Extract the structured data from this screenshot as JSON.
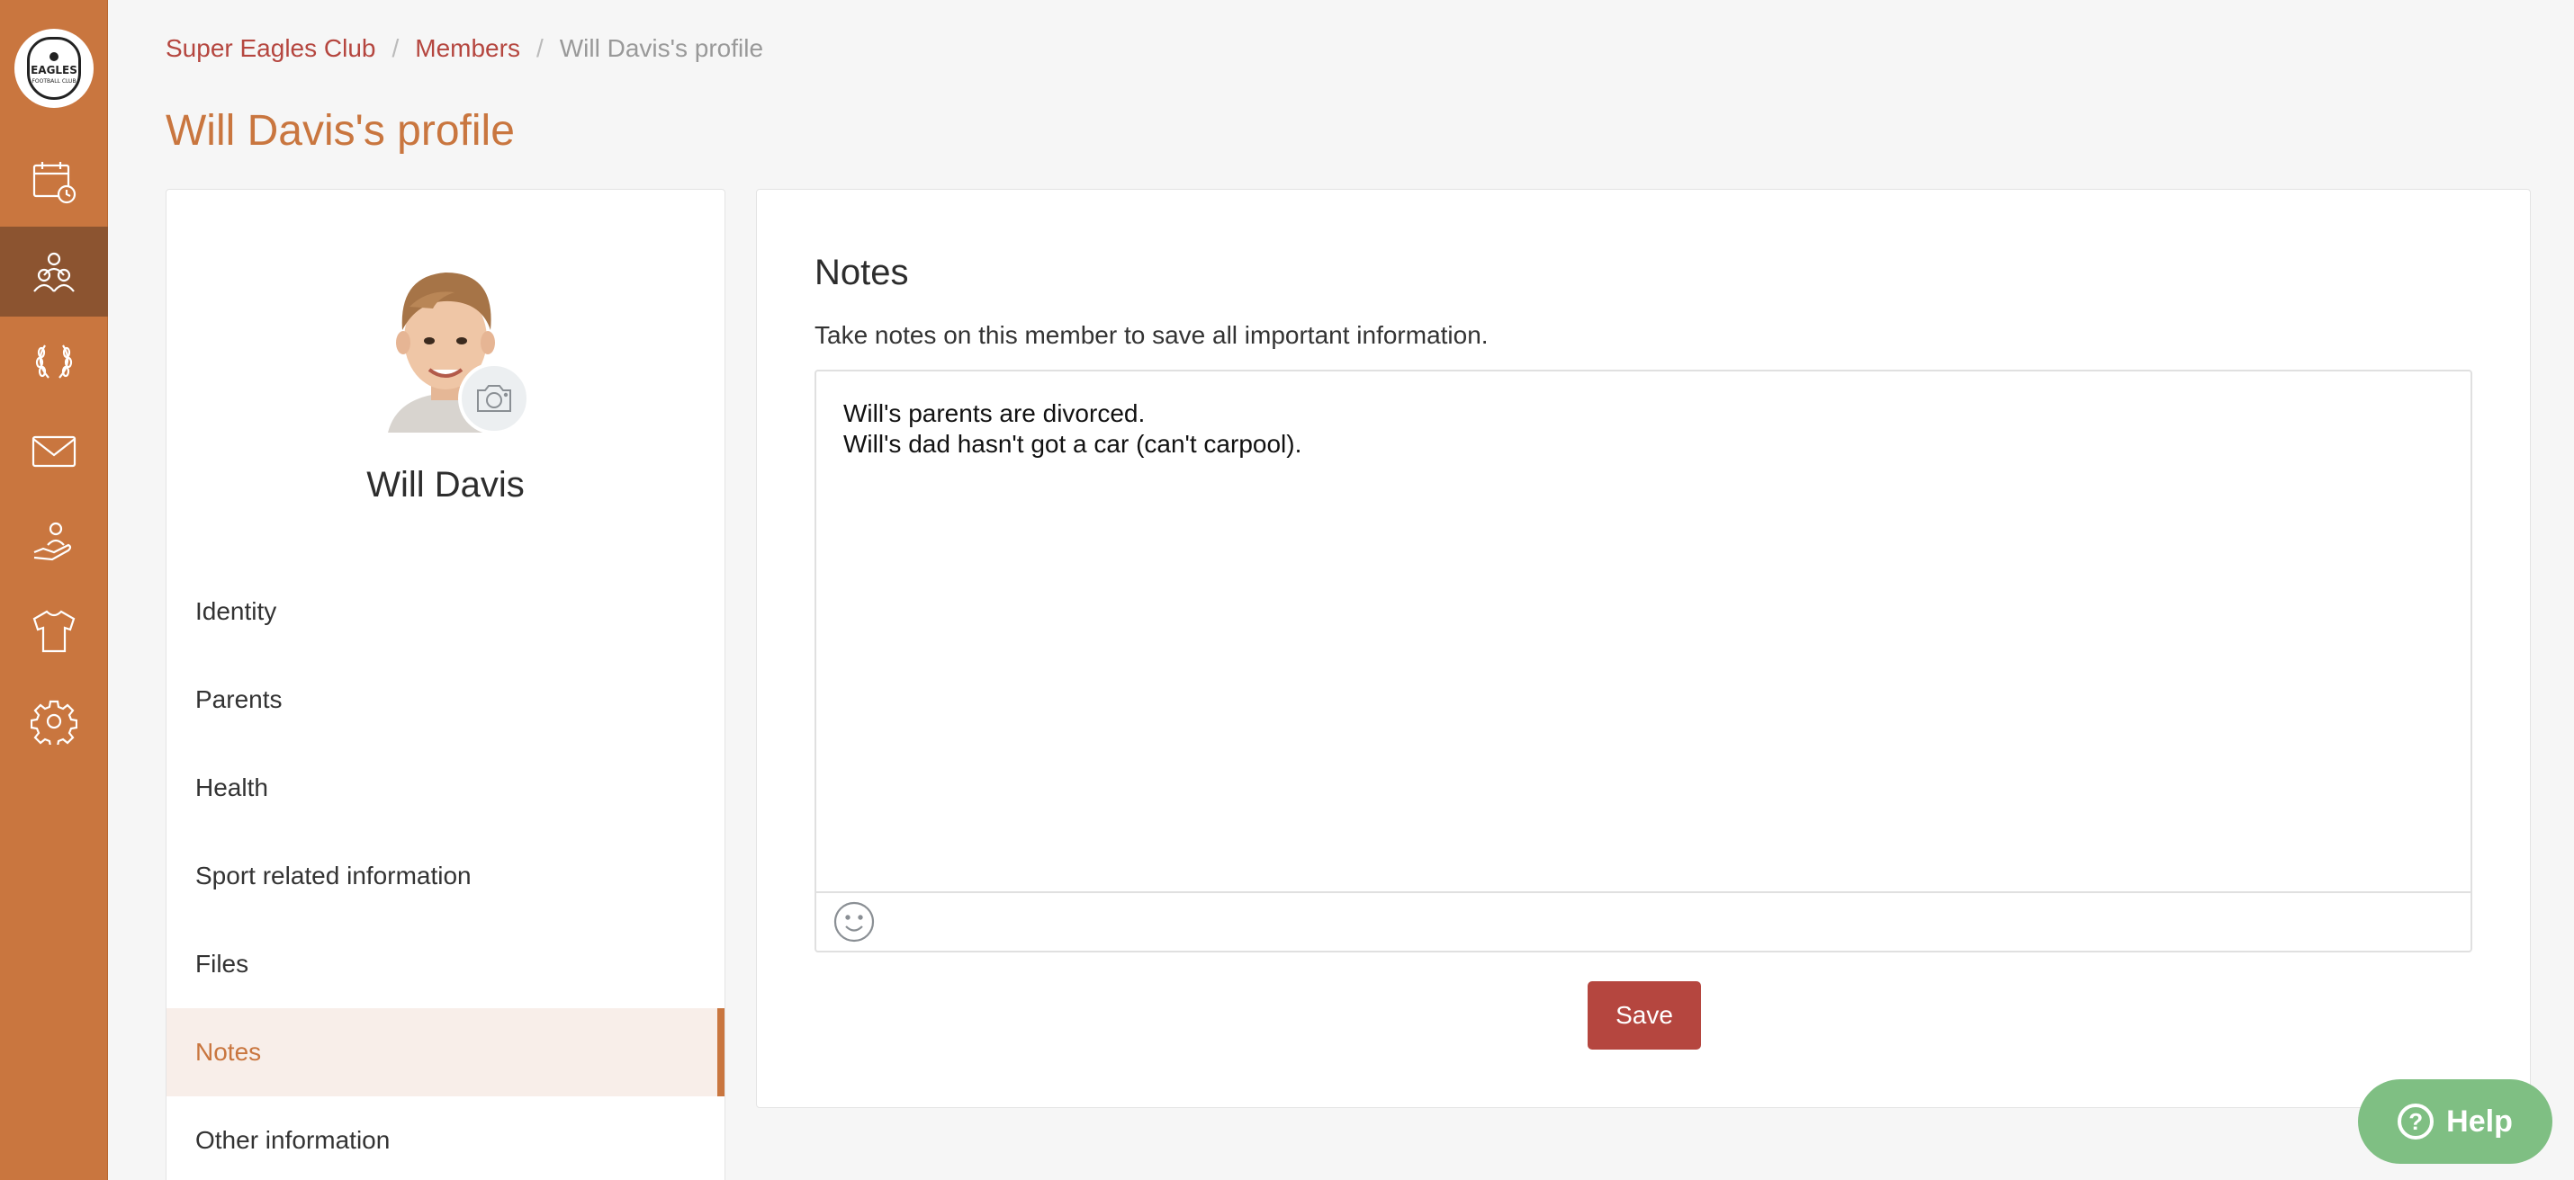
{
  "sidebar": {
    "logo": {
      "text": "EAGLES",
      "subtext": "FOOTBALL CLUB"
    },
    "items": [
      {
        "icon": "calendar-icon",
        "active": false
      },
      {
        "icon": "members-icon",
        "active": true
      },
      {
        "icon": "laurel-icon",
        "active": false
      },
      {
        "icon": "mail-icon",
        "active": false
      },
      {
        "icon": "donation-icon",
        "active": false
      },
      {
        "icon": "shirt-icon",
        "active": false
      },
      {
        "icon": "gear-icon",
        "active": false
      }
    ]
  },
  "breadcrumb": {
    "club": "Super Eagles Club",
    "separator": "/",
    "members": "Members",
    "current": "Will Davis's profile"
  },
  "page_title": "Will Davis's profile",
  "profile": {
    "name": "Will Davis",
    "menu": [
      {
        "label": "Identity",
        "active": false
      },
      {
        "label": "Parents",
        "active": false
      },
      {
        "label": "Health",
        "active": false
      },
      {
        "label": "Sport related information",
        "active": false
      },
      {
        "label": "Files",
        "active": false
      },
      {
        "label": "Notes",
        "active": true
      },
      {
        "label": "Other information",
        "active": false
      }
    ]
  },
  "notes": {
    "title": "Notes",
    "description": "Take notes on this member to save all important information.",
    "content_lines": [
      "Will's parents are divorced.",
      "Will's dad hasn't got a car (can't carpool)."
    ],
    "save_label": "Save"
  },
  "help": {
    "label": "Help"
  },
  "colors": {
    "brand": "#c9763f",
    "brand_dark": "#8c5430",
    "accent_red": "#b5463f",
    "help_green": "#7fbf83"
  }
}
